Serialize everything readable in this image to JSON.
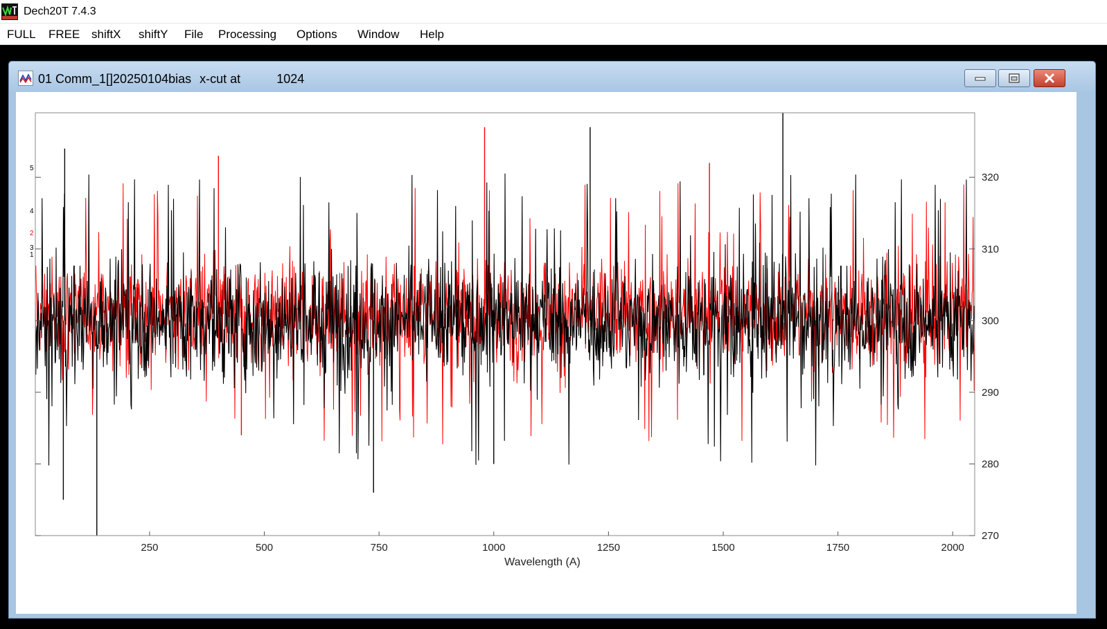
{
  "app": {
    "title": "Dech20T 7.4.3",
    "icon": "dech-logo-icon"
  },
  "menu": [
    "FULL",
    "FREE",
    "shiftX",
    "shiftY",
    "File",
    "Processing",
    "Options",
    "Window",
    "Help"
  ],
  "child_window": {
    "icon": "graph-icon",
    "title": "01 Comm_1[]20250104bias",
    "cut_label": "x-cut at",
    "cut_position": "1024",
    "buttons": [
      "minimize-icon",
      "restore-icon",
      "close-icon"
    ]
  },
  "colors": {
    "primary_series": "#000000",
    "secondary_series": "#ff0000",
    "window_frame": "#a8c5e2"
  },
  "left_axis_fragments": [
    {
      "text": "5",
      "color": "#000000"
    },
    {
      "text": "4",
      "color": "#000000"
    },
    {
      "text": "2",
      "color": "#ff0000"
    },
    {
      "text": "3",
      "color": "#000000"
    },
    {
      "text": "1",
      "color": "#000000"
    }
  ],
  "chart_data": {
    "type": "line",
    "title": "",
    "xlabel": "Wavelength (A)",
    "ylabel": "",
    "xlim": [
      1,
      2048
    ],
    "ylim": [
      270,
      329
    ],
    "x_ticks": [
      250,
      500,
      750,
      1000,
      1250,
      1500,
      1750,
      2000
    ],
    "y_ticks": [
      270,
      280,
      290,
      300,
      310,
      320
    ],
    "y_axis_side": "right",
    "grid": false,
    "legend": "none",
    "series": [
      {
        "color": "#000000",
        "mean": 300,
        "typical_range": [
          287,
          313
        ],
        "notable_points": [
          [
            62,
            275
          ],
          [
            65,
            324
          ],
          [
            135,
            270
          ],
          [
            738,
            276
          ],
          [
            1000,
            280
          ],
          [
            1210,
            327
          ],
          [
            1630,
            329
          ]
        ]
      },
      {
        "color": "#ff0000",
        "mean": 301,
        "typical_range": [
          289,
          312
        ],
        "notable_points": [
          [
            400,
            323
          ],
          [
            450,
            284
          ],
          [
            980,
            327
          ],
          [
            1470,
            322
          ]
        ]
      }
    ]
  }
}
